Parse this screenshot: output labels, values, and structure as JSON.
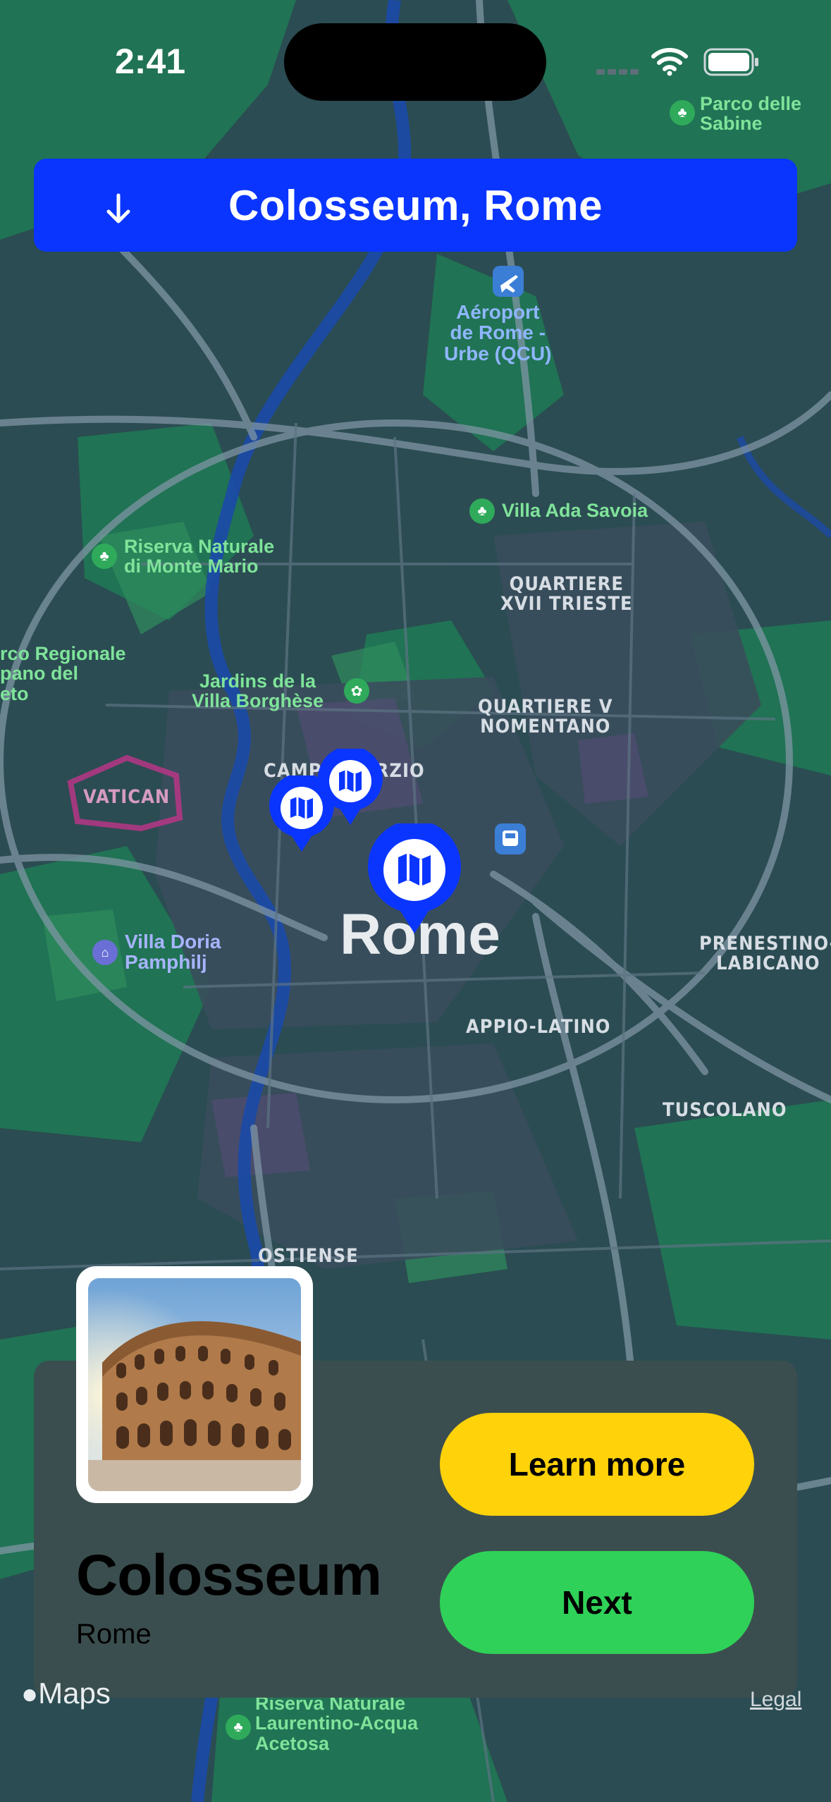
{
  "status_bar": {
    "time": "2:41"
  },
  "header": {
    "title": "Colosseum, Rome",
    "icon": "arrow-down-icon"
  },
  "map": {
    "labels": {
      "parco_sabine": "Parco delle\nSabine",
      "airport": "Aéroport\nde Rome -\nUrbe (QCU)",
      "villa_ada": "Villa Ada Savoia",
      "riserva_mario": "Riserva Naturale\ndi Monte Mario",
      "quartiere_xvii": "QUARTIERE\nXVII TRIESTE",
      "parco_regionale": "rco Regionale\npano del\neto",
      "jardins": "Jardins de la\nVilla Borghèse",
      "quartiere_v": "QUARTIERE V\nNOMENTANO",
      "campo_marzio": "CAMPO MARZIO",
      "vatican": "VATICAN",
      "rome": "Rome",
      "villa_doria": "Villa Doria\nPamphilj",
      "prenestino": "PRENESTINO-\nLABICANO",
      "appio": "APPIO-LATINO",
      "tuscolano": "TUSCOLANO",
      "ostiense": "OSTIENSE",
      "riserva_laurentino": "Riserva Naturale\nLaurentino-Acqua\nAcetosa"
    }
  },
  "card": {
    "title": "Colosseum",
    "subtitle": "Rome",
    "learn_more": "Learn more",
    "next": "Next"
  },
  "footer": {
    "maps": "Maps",
    "legal": "Legal"
  },
  "colors": {
    "accent_blue": "#0a35ff",
    "learn_yellow": "#ffd20a",
    "next_green": "#2fd158"
  }
}
